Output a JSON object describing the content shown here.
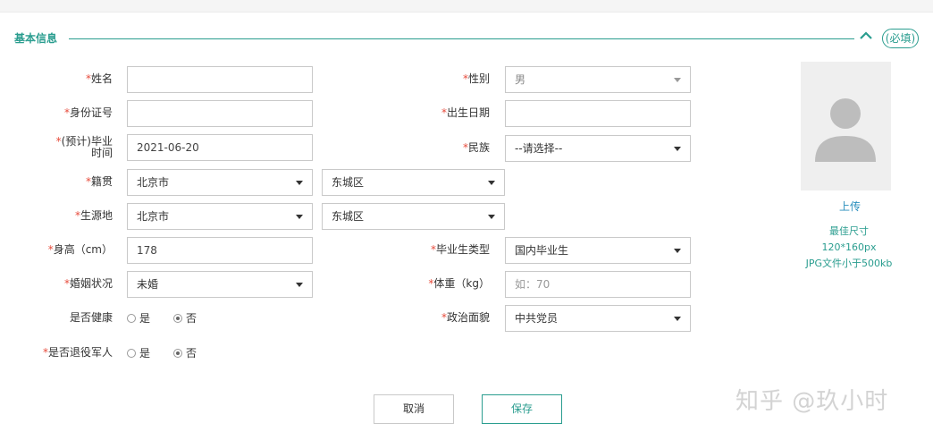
{
  "section": {
    "title": "基本信息",
    "required_badge": "必填"
  },
  "required_mark": "*",
  "form": {
    "name": {
      "label": "姓名",
      "value": ""
    },
    "gender": {
      "label": "性别",
      "value": "男"
    },
    "id_number": {
      "label": "身份证号",
      "value": ""
    },
    "birth_date": {
      "label": "出生日期",
      "value": ""
    },
    "graduation": {
      "label_line1": "(预计)毕业",
      "label_line2": "时间",
      "value": "2021-06-20"
    },
    "ethnicity": {
      "label": "民族",
      "value": "--请选择--"
    },
    "native_place": {
      "label": "籍贯",
      "city": "北京市",
      "district": "东城区"
    },
    "origin": {
      "label": "生源地",
      "city": "北京市",
      "district": "东城区"
    },
    "height": {
      "label": "身高（cm）",
      "value": "178"
    },
    "graduate_type": {
      "label": "毕业生类型",
      "value": "国内毕业生"
    },
    "marital": {
      "label": "婚姻状况",
      "value": "未婚"
    },
    "weight": {
      "label": "体重（kg）",
      "placeholder": "如：70"
    },
    "healthy": {
      "label": "是否健康",
      "yes": "是",
      "no": "否",
      "selected": "否"
    },
    "political": {
      "label": "政治面貌",
      "value": "中共党员"
    },
    "veteran": {
      "label": "是否退役军人",
      "yes": "是",
      "no": "否",
      "selected": "否"
    }
  },
  "photo": {
    "upload_label": "上传",
    "hint_line1": "最佳尺寸",
    "hint_line2": "120*160px",
    "hint_line3": "JPG文件小于500kb"
  },
  "actions": {
    "cancel": "取消",
    "save": "保存"
  },
  "watermark": "知乎 @玖小时",
  "colors": {
    "accent": "#2a9d8f",
    "required": "#e74c3c",
    "link": "#2a8fbd"
  }
}
